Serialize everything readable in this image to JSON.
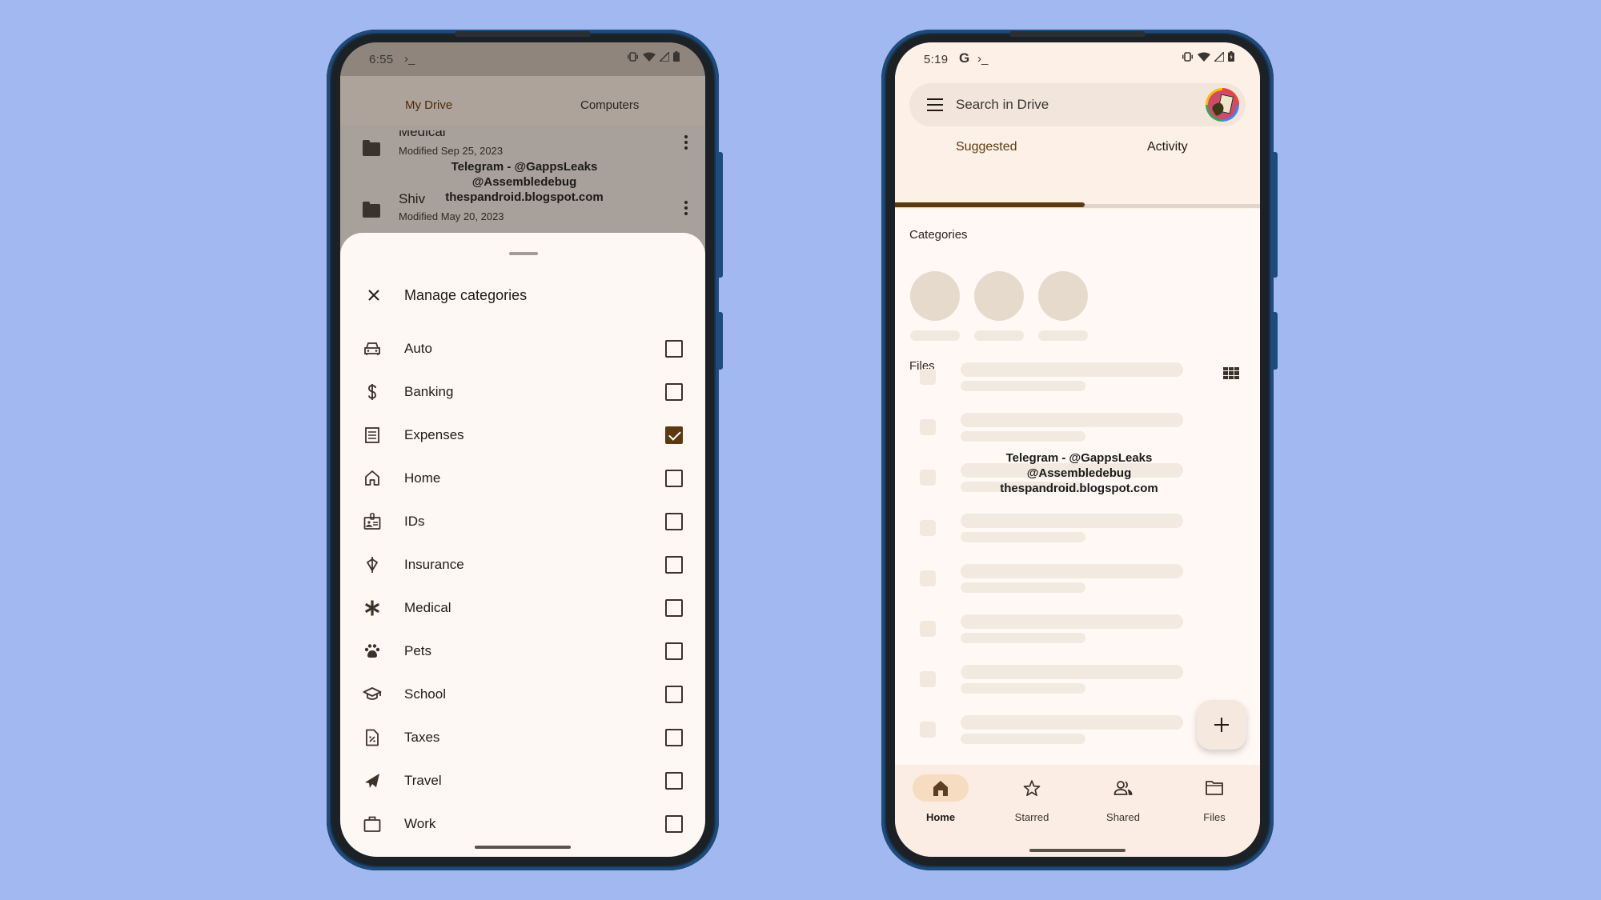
{
  "left_phone": {
    "status": {
      "time": "6:55",
      "extra": "›_",
      "icons": [
        "vibrate-icon",
        "wifi-icon",
        "signal-icon",
        "battery-icon"
      ]
    },
    "tabs": [
      {
        "label": "My Drive",
        "active": true
      },
      {
        "label": "Computers",
        "active": false
      }
    ],
    "folders": [
      {
        "name": "Medical",
        "meta": "Modified Sep 25, 2023"
      },
      {
        "name": "Shiv",
        "meta": "Modified May 20, 2023"
      }
    ],
    "watermark": [
      "Telegram - @GappsLeaks",
      "@Assembledebug",
      "thespandroid.blogspot.com"
    ],
    "sheet": {
      "title": "Manage categories",
      "categories": [
        {
          "label": "Auto",
          "icon": "car-icon",
          "checked": false
        },
        {
          "label": "Banking",
          "icon": "dollar-icon",
          "checked": false
        },
        {
          "label": "Expenses",
          "icon": "receipt-icon",
          "checked": true
        },
        {
          "label": "Home",
          "icon": "home-icon",
          "checked": false
        },
        {
          "label": "IDs",
          "icon": "id-badge-icon",
          "checked": false
        },
        {
          "label": "Insurance",
          "icon": "umbrella-icon",
          "checked": false
        },
        {
          "label": "Medical",
          "icon": "asterisk-icon",
          "checked": false
        },
        {
          "label": "Pets",
          "icon": "paw-icon",
          "checked": false
        },
        {
          "label": "School",
          "icon": "graduation-cap-icon",
          "checked": false
        },
        {
          "label": "Taxes",
          "icon": "tax-document-icon",
          "checked": false
        },
        {
          "label": "Travel",
          "icon": "airplane-icon",
          "checked": false
        },
        {
          "label": "Work",
          "icon": "briefcase-icon",
          "checked": false
        }
      ]
    }
  },
  "right_phone": {
    "status": {
      "time": "5:19",
      "google": "G",
      "extra": "›_",
      "icons": [
        "vibrate-icon",
        "wifi-icon",
        "signal-icon",
        "battery-charging-icon"
      ]
    },
    "search": {
      "placeholder": "Search in Drive"
    },
    "tabs": [
      {
        "label": "Suggested",
        "active": true
      },
      {
        "label": "Activity",
        "active": false
      }
    ],
    "sections": {
      "categories": "Categories",
      "files": "Files"
    },
    "watermark": [
      "Telegram - @GappsLeaks",
      "@Assembledebug",
      "thespandroid.blogspot.com"
    ],
    "fab_label": "+",
    "nav": [
      {
        "label": "Home",
        "icon": "home-icon",
        "active": true
      },
      {
        "label": "Starred",
        "icon": "star-icon",
        "active": false
      },
      {
        "label": "Shared",
        "icon": "people-icon",
        "active": false
      },
      {
        "label": "Files",
        "icon": "folder-icon",
        "active": false
      }
    ]
  },
  "colors": {
    "background": "#a2b8f0",
    "accent": "#5b3a12",
    "sheet": "#fef8f4",
    "surface": "#fdf0e6",
    "nav_active": "#f6dcc0"
  }
}
